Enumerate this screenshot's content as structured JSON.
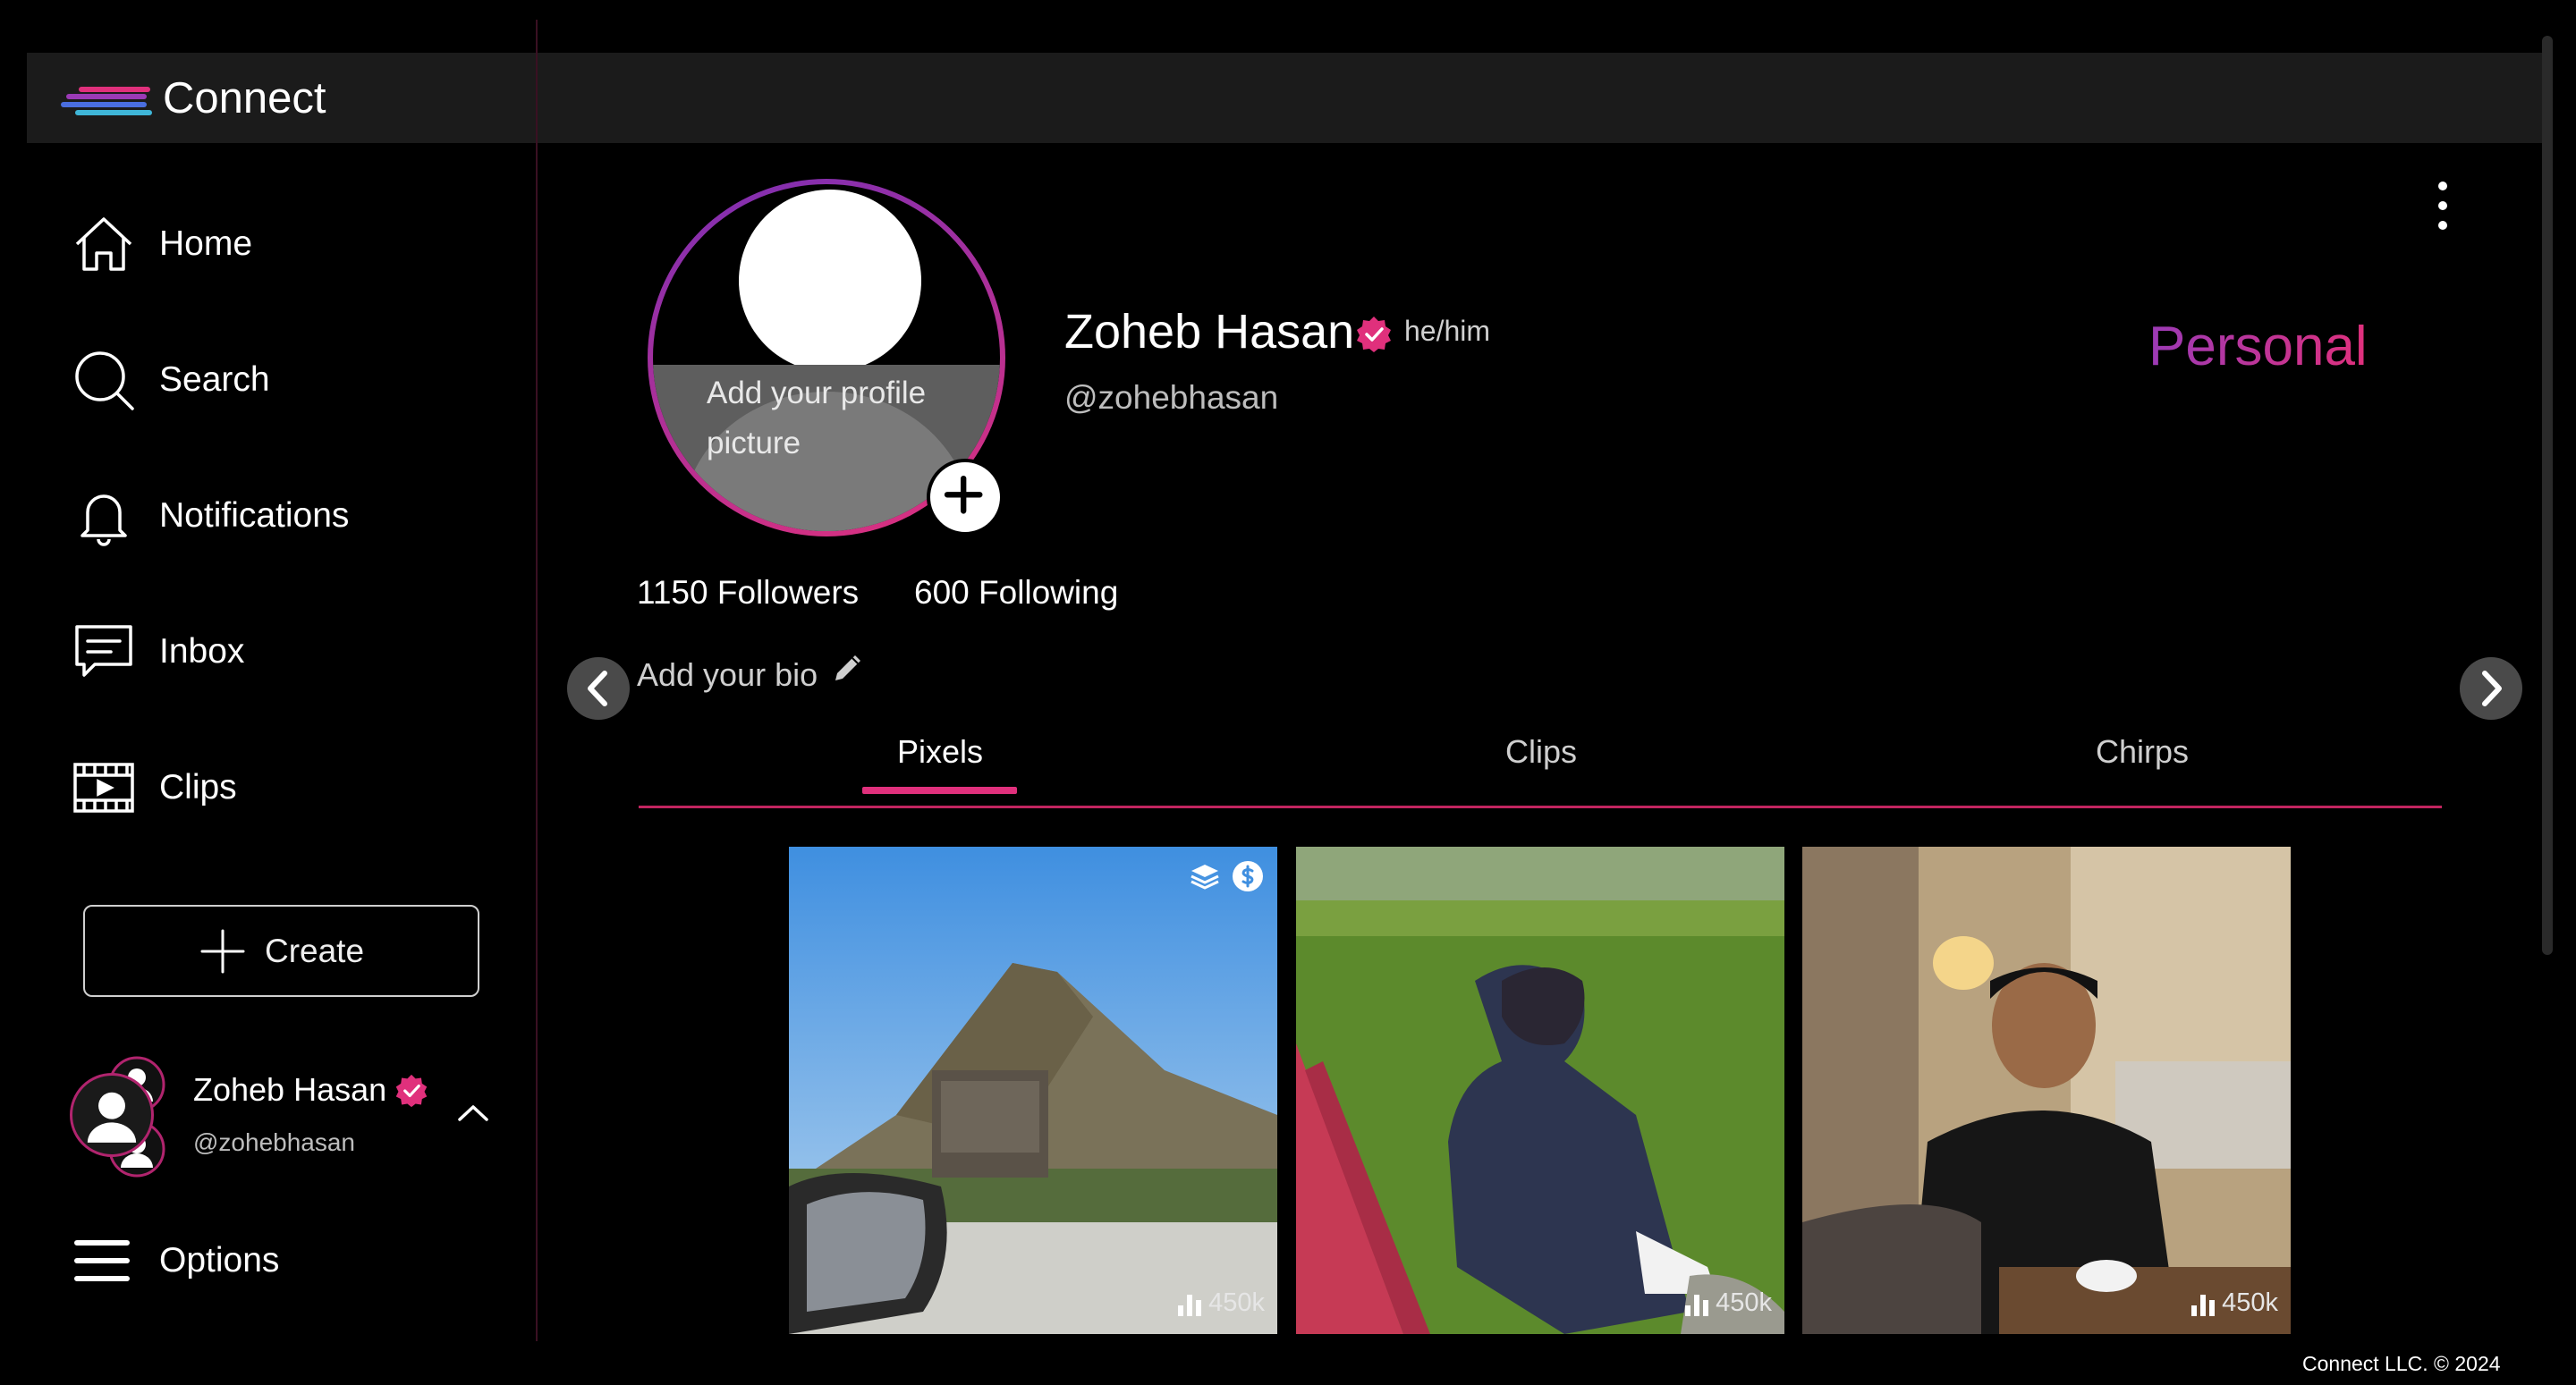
{
  "app": {
    "name": "Connect"
  },
  "sidebar": {
    "items": [
      {
        "label": "Home",
        "icon": "home-icon"
      },
      {
        "label": "Search",
        "icon": "search-icon"
      },
      {
        "label": "Notifications",
        "icon": "bell-icon"
      },
      {
        "label": "Inbox",
        "icon": "chat-icon"
      },
      {
        "label": "Clips",
        "icon": "film-icon"
      }
    ],
    "create_label": "Create",
    "options_label": "Options",
    "account": {
      "name": "Zoheb Hasan",
      "handle": "@zohebhasan"
    }
  },
  "profile": {
    "add_picture_text": "Add your profile picture",
    "name": "Zoheb Hasan",
    "pronouns": "he/him",
    "handle": "@zohebhasan",
    "account_type": "Personal",
    "followers": "1150 Followers",
    "following": "600 Following",
    "bio_placeholder": "Add your bio"
  },
  "tabs": [
    {
      "label": "Pixels",
      "active": true
    },
    {
      "label": "Clips",
      "active": false
    },
    {
      "label": "Chirps",
      "active": false
    }
  ],
  "posts": [
    {
      "views": "450k",
      "badges": [
        "stack-icon",
        "dollar-icon"
      ]
    },
    {
      "views": "450k"
    },
    {
      "views": "450k"
    }
  ],
  "footer": {
    "copyright": "Connect LLC. © 2024"
  },
  "colors": {
    "accent": "#e0307c",
    "accent_purple": "#9b3ab6",
    "topbar": "#1b1b1b",
    "background": "#000000"
  }
}
